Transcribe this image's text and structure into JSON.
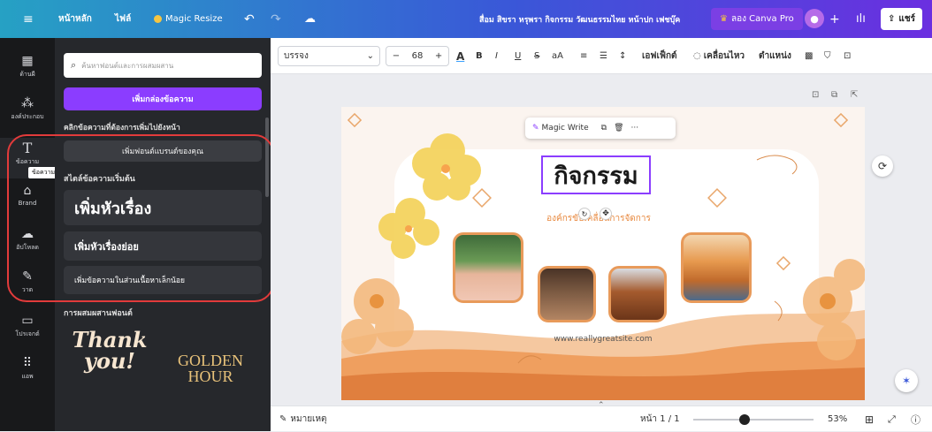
{
  "topbar": {
    "menu_icon": "hamburger-icon",
    "home": "หน้าหลัก",
    "file": "ไฟล์",
    "magic_resize": "Magic Resize",
    "doc_title": "สื่อม สิขรา หรุพรา กิจกรรม วัฒนธรรมไทย หน้าปก เฟชบุ๊ค",
    "try_pro": "ลอง Canva Pro",
    "share": "แชร์",
    "colors": {
      "pro_bg": "#7b3fe4",
      "share_bg": "#ffffff"
    }
  },
  "rail": {
    "items": [
      {
        "label": "ด้านผี",
        "icon": "template-icon"
      },
      {
        "label": "องค์ประกอบ",
        "icon": "elements-icon"
      },
      {
        "label": "ข้อความ",
        "icon": "text-icon"
      },
      {
        "label": "Brand",
        "icon": "brand-icon"
      },
      {
        "label": "อัปโหลด",
        "icon": "upload-icon"
      },
      {
        "label": "วาด",
        "icon": "draw-icon"
      },
      {
        "label": "โปรเจกต์",
        "icon": "folder-icon"
      },
      {
        "label": "แอพ",
        "icon": "apps-icon"
      }
    ],
    "tooltip": "ข้อความ"
  },
  "panel": {
    "search_placeholder": "ค้นหาฟอนต์และการผสมผสาน",
    "add_textbox": "เพิ่มกล่องข้อความ",
    "click_hint": "คลิกข้อความที่ต้องการเพิ่มไปยังหน้า",
    "brand_fonts": "เพิ่มฟอนต์แบรนด์ของคุณ",
    "default_styles": "สไตล์ข้อความเริ่มต้น",
    "heading": "เพิ่มหัวเรื่อง",
    "subheading": "เพิ่มหัวเรื่องย่อย",
    "body": "เพิ่มข้อความในส่วนเนื้อหาเล็กน้อย",
    "combos": "การผสมผสานฟอนต์",
    "combo1_line1": "Thank",
    "combo1_line2": "you!",
    "combo2_line1": "GOLDEN",
    "combo2_line2": "HOUR"
  },
  "toolbar": {
    "font": "บรรจง",
    "font_size": "68",
    "effects": "เอฟเฟ็กต์",
    "animate": "เคลื่อนไหว",
    "position": "ตำแหน่ง"
  },
  "canvas": {
    "magic_write": "Magic Write",
    "title": "กิจกรรม",
    "subtitle": "องค์กรขับเคลื่อนการจัดการ",
    "url": "www.reallygreatsite.com"
  },
  "footer": {
    "notes": "หมายเหตุ",
    "page": "หน้า 1 / 1",
    "zoom_percent": 53,
    "zoom": "53%"
  }
}
